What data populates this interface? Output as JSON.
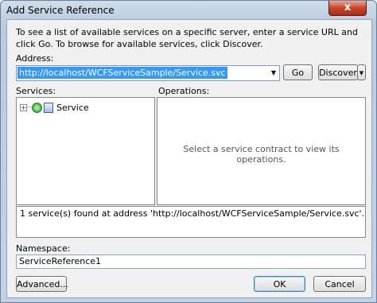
{
  "window": {
    "title": "Add Service Reference",
    "close_glyph": "x"
  },
  "intro": {
    "text": "To see a list of available services on a specific server, enter a service URL and click Go. To browse for available services, click Discover."
  },
  "address": {
    "label": "Address:",
    "value": "http://localhost/WCFServiceSample/Service.svc",
    "go_label": "Go",
    "discover_label": "Discover"
  },
  "services": {
    "label": "Services:",
    "items": [
      {
        "label": "Service",
        "expander": "+",
        "icon": "service-icon"
      }
    ]
  },
  "operations": {
    "label": "Operations:",
    "placeholder": "Select a service contract to view its operations."
  },
  "status": {
    "text": "1 service(s) found at address 'http://localhost/WCFServiceSample/Service.svc'."
  },
  "namespace": {
    "label": "Namespace:",
    "value": "ServiceReference1"
  },
  "footer": {
    "advanced_label": "Advanced...",
    "ok_label": "OK",
    "cancel_label": "Cancel"
  }
}
